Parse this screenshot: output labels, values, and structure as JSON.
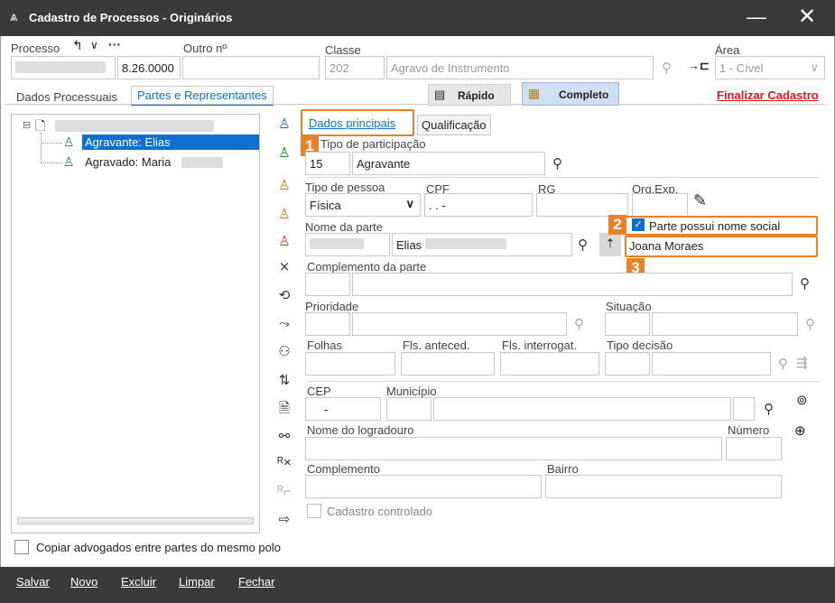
{
  "window": {
    "title": "Cadastro de Processos - Originários"
  },
  "header": {
    "processo_label": "Processo",
    "processo_value": "8.26.0000",
    "outro_label": "Outro nº",
    "classe_label": "Classe",
    "classe_code": "202",
    "classe_name": "Agravo de Instrumento",
    "area_label": "Área",
    "area_value": "1 - Cível"
  },
  "tabs": {
    "dados": "Dados Processuais",
    "partes": "Partes e Representantes"
  },
  "view": {
    "rapido": "Rápido",
    "completo": "Completo",
    "finalizar": "Finalizar Cadastro"
  },
  "tree": {
    "item1": "Agravante: Elias",
    "item2": "Agravado: Maria"
  },
  "subtabs": {
    "principais": "Dados principais",
    "qualificacao": "Qualificação"
  },
  "form": {
    "tipo_part_label": "Tipo de participação",
    "tipo_part_code": "15",
    "tipo_part_value": "Agravante",
    "tipo_pessoa_label": "Tipo de pessoa",
    "tipo_pessoa_value": "Física",
    "cpf_label": "CPF",
    "cpf_value": " .   .   -",
    "rg_label": "RG",
    "orgexp_label": "Org.Exp.",
    "nome_label": "Nome da parte",
    "nome_value": "Elias",
    "social_checkbox": "Parte possui nome social",
    "social_value": "Joana Moraes",
    "complemento_parte_label": "Complemento da parte",
    "prioridade_label": "Prioridade",
    "situacao_label": "Situação",
    "folhas_label": "Folhas",
    "fls_anteced_label": "Fls. anteced.",
    "fls_interrogat_label": "Fls. interrogat.",
    "tipo_decisao_label": "Tipo decisão",
    "cep_label": "CEP",
    "cep_value": "-",
    "municipio_label": "Município",
    "logradouro_label": "Nome do logradouro",
    "numero_label": "Número",
    "complemento_label": "Complemento",
    "bairro_label": "Bairro",
    "cadastro_controlado": "Cadastro controlado"
  },
  "badges": {
    "b1": "1",
    "b2": "2",
    "b3": "3"
  },
  "footer": {
    "copiar": "Copiar advogados entre partes do mesmo polo"
  },
  "bottom": {
    "salvar": "Salvar",
    "novo": "Novo",
    "excluir": "Excluir",
    "limpar": "Limpar",
    "fechar": "Fechar"
  },
  "colors": {
    "accent": "#e8822a",
    "selection": "#0c6fd1",
    "finalizar": "#e0141e"
  }
}
